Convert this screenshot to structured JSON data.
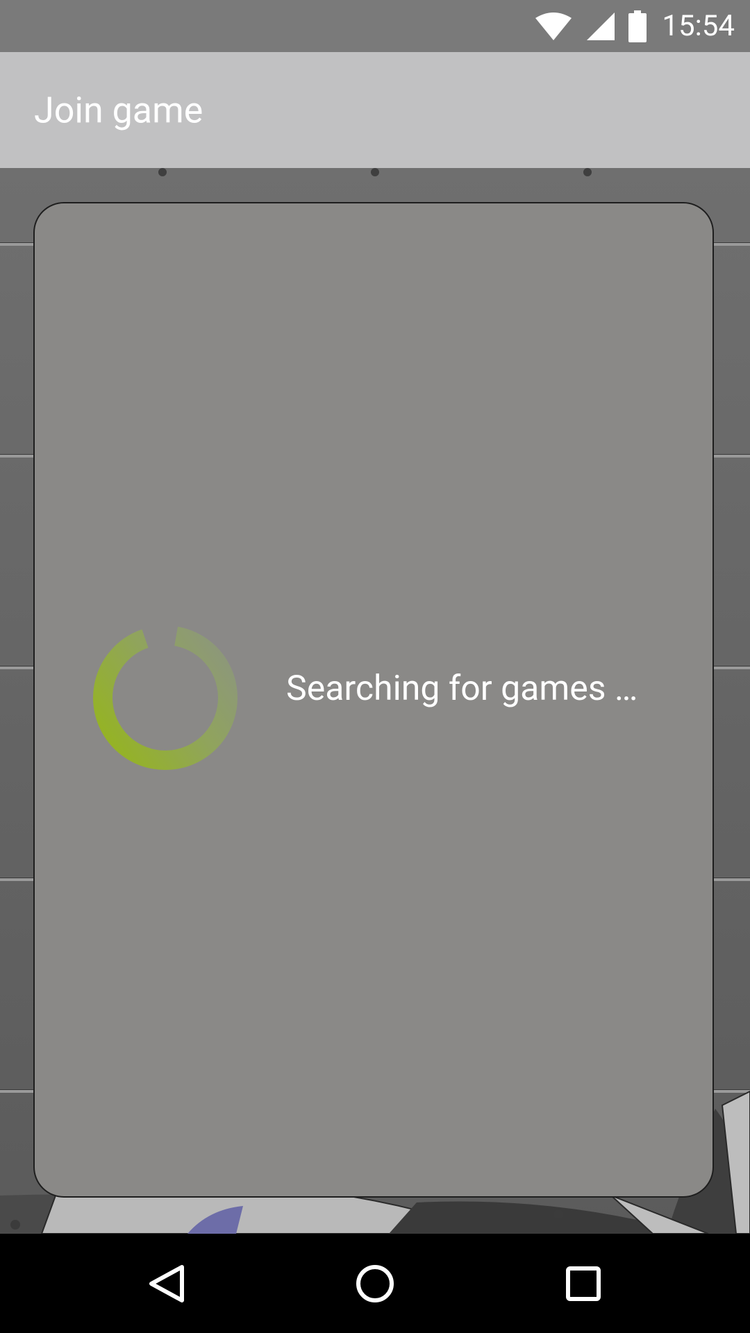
{
  "status_bar": {
    "time": "15:54",
    "icons": [
      "wifi-icon",
      "cell-signal-icon",
      "battery-icon"
    ]
  },
  "app_bar": {
    "title": "Join game"
  },
  "dialog": {
    "message": "Searching for games …",
    "progress_color": "#96b61a"
  },
  "nav_bar": {
    "buttons": [
      "back",
      "home",
      "recents"
    ]
  }
}
